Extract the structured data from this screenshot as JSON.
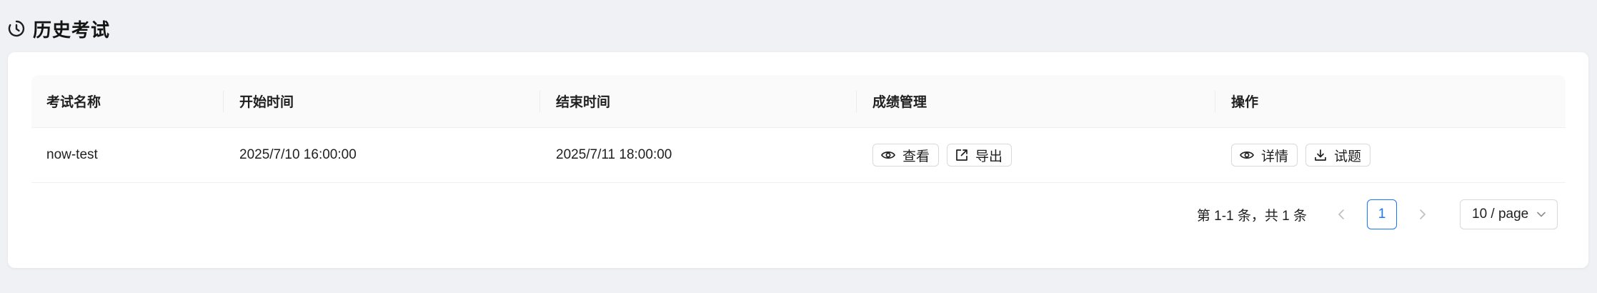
{
  "header": {
    "icon": "history-clock-icon",
    "title": "历史考试"
  },
  "table": {
    "columns": [
      "考试名称",
      "开始时间",
      "结束时间",
      "成绩管理",
      "操作"
    ],
    "rows": [
      {
        "name": "now-test",
        "start": "2025/7/10 16:00:00",
        "end": "2025/7/11 18:00:00",
        "score_actions": [
          {
            "icon": "eye-icon",
            "label": "查看"
          },
          {
            "icon": "export-icon",
            "label": "导出"
          }
        ],
        "actions": [
          {
            "icon": "eye-icon",
            "label": "详情"
          },
          {
            "icon": "download-icon",
            "label": "试题"
          }
        ]
      }
    ]
  },
  "pagination": {
    "total_text": "第 1-1 条，共 1 条",
    "current_page": "1",
    "page_size": "10 / page"
  },
  "colors": {
    "accent": "#1677ff",
    "background": "#f0f1f5",
    "card": "#ffffff",
    "header_row": "#fafafa",
    "border": "#d9d9d9"
  }
}
